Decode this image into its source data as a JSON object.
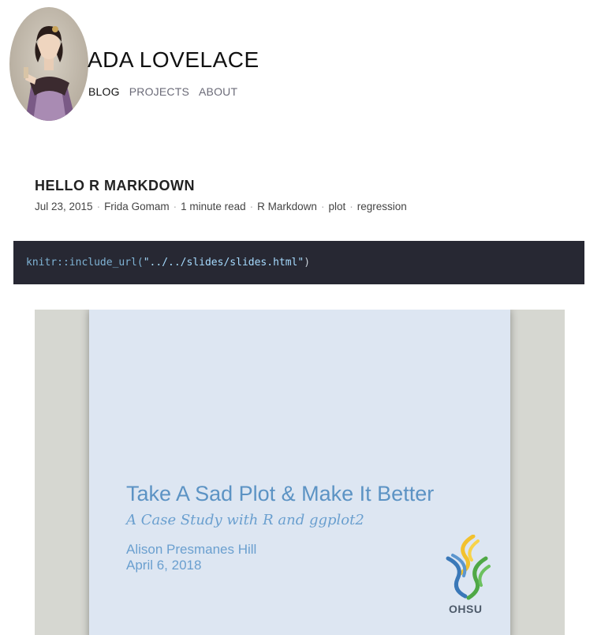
{
  "site": {
    "title": "ADA LOVELACE",
    "nav": [
      {
        "label": "BLOG",
        "active": true
      },
      {
        "label": "PROJECTS",
        "active": false
      },
      {
        "label": "ABOUT",
        "active": false
      }
    ]
  },
  "post": {
    "title": "HELLO R MARKDOWN",
    "meta": {
      "date": "Jul 23, 2015",
      "author": "Frida Gomam",
      "read_time": "1 minute read",
      "categories": [
        "R Markdown",
        "plot",
        "regression"
      ],
      "separator": "·"
    },
    "code": {
      "fn": "knitr::include_url(",
      "arg": "\"../../slides/slides.html\"",
      "close": ")"
    }
  },
  "slide": {
    "title": "Take A Sad Plot & Make It Better",
    "subtitle": "A Case Study with R and ggplot2",
    "author": "Alison Presmanes Hill",
    "date": "April 6, 2018",
    "logo_text": "OHSU"
  },
  "colors": {
    "code_bg": "#272833",
    "slide_bg": "#dde6f2",
    "slide_accent": "#5c93c4",
    "frame_bg": "#d6d7d1"
  }
}
